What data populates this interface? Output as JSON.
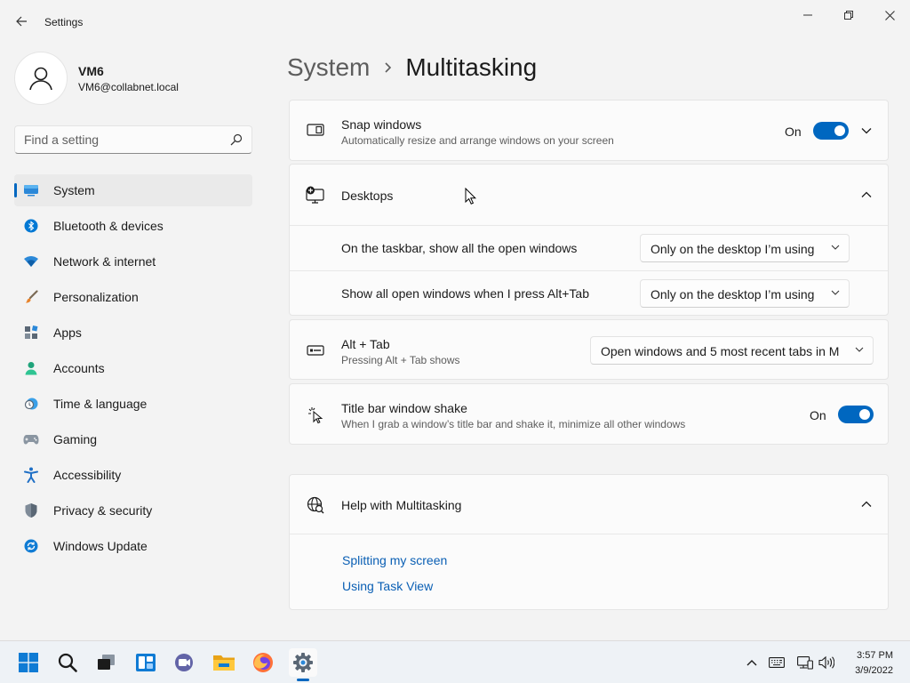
{
  "window": {
    "app_title": "Settings",
    "icons": {
      "back": "back-arrow-icon",
      "minimize": "minimize-icon",
      "maximize": "restore-icon",
      "close": "close-icon"
    }
  },
  "profile": {
    "name": "VM6",
    "email": "VM6@collabnet.local",
    "icon": "person-icon"
  },
  "search": {
    "placeholder": "Find a setting",
    "icon": "search-icon"
  },
  "sidebar": {
    "selected_index": 0,
    "accent_color": "#0067c0",
    "items": [
      {
        "label": "System",
        "icon": "system-icon"
      },
      {
        "label": "Bluetooth & devices",
        "icon": "bluetooth-icon"
      },
      {
        "label": "Network & internet",
        "icon": "network-icon"
      },
      {
        "label": "Personalization",
        "icon": "paintbrush-icon"
      },
      {
        "label": "Apps",
        "icon": "apps-icon"
      },
      {
        "label": "Accounts",
        "icon": "accounts-icon"
      },
      {
        "label": "Time & language",
        "icon": "clock-globe-icon"
      },
      {
        "label": "Gaming",
        "icon": "controller-icon"
      },
      {
        "label": "Accessibility",
        "icon": "accessibility-icon"
      },
      {
        "label": "Privacy & security",
        "icon": "shield-icon"
      },
      {
        "label": "Windows Update",
        "icon": "update-icon"
      }
    ]
  },
  "breadcrumb": {
    "parent": "System",
    "current": "Multitasking"
  },
  "snap": {
    "title": "Snap windows",
    "subtitle": "Automatically resize and arrange windows on your screen",
    "toggle_label": "On",
    "toggle_on": true,
    "icon": "snap-windows-icon"
  },
  "desktops": {
    "title": "Desktops",
    "icon": "desktops-icon",
    "expanded": true,
    "rows": [
      {
        "label": "On the taskbar, show all the open windows",
        "value": "Only on the desktop I’m using"
      },
      {
        "label": "Show all open windows when I press Alt+Tab",
        "value": "Only on the desktop I’m using"
      }
    ]
  },
  "alttab": {
    "title": "Alt + Tab",
    "subtitle": "Pressing Alt + Tab shows",
    "value": "Open windows and 5 most recent tabs in M",
    "icon": "alt-tab-icon"
  },
  "shake": {
    "title": "Title bar window shake",
    "subtitle": "When I grab a window’s title bar and shake it, minimize all other windows",
    "toggle_label": "On",
    "toggle_on": true,
    "icon": "window-shake-icon"
  },
  "help": {
    "title": "Help with Multitasking",
    "icon": "help-globe-icon",
    "links": [
      "Splitting my screen",
      "Using Task View"
    ]
  },
  "taskbar": {
    "apps": [
      "start-icon",
      "search-icon",
      "task-view-icon",
      "widgets-icon",
      "chat-icon",
      "file-explorer-icon",
      "firefox-icon",
      "settings-icon"
    ],
    "active_app": "settings-icon",
    "tray": [
      "chevron-up-icon",
      "keyboard-icon",
      "network-icon",
      "volume-icon"
    ],
    "time": "3:57 PM",
    "date": "3/9/2022"
  }
}
